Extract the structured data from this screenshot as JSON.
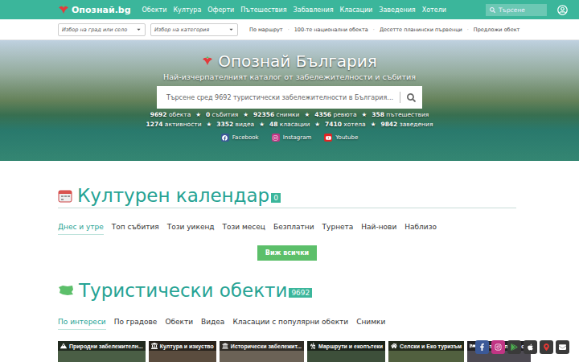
{
  "nav": {
    "logo": "Опознай.bg",
    "items": [
      "Обекти",
      "Култура",
      "Оферти",
      "Пътешествия",
      "Забавления",
      "Класации",
      "Заведения",
      "Хотели"
    ],
    "search_placeholder": "Търсене"
  },
  "filters": {
    "city_placeholder": "Избор на град или село",
    "category_placeholder": "Избор на категория",
    "links": [
      "По маршрут",
      "100-те национални обекта",
      "Десетте планински първенци",
      "Предложи обект"
    ],
    "separator": "·"
  },
  "hero": {
    "title": "Опознай България",
    "subtitle": "Най-изчерпателният каталог от забележителности и събития",
    "search_placeholder": "Търсене сред 9692 туристически забележителности в България...",
    "star": "★",
    "stats_rows": [
      [
        {
          "value": "9692",
          "label": "обекта"
        },
        {
          "value": "0",
          "label": "събития"
        },
        {
          "value": "92356",
          "label": "снимки"
        },
        {
          "value": "4356",
          "label": "ревюта"
        },
        {
          "value": "358",
          "label": "пътешествия"
        }
      ],
      [
        {
          "value": "1274",
          "label": "активности"
        },
        {
          "value": "3352",
          "label": "видеа"
        },
        {
          "value": "48",
          "label": "класации"
        },
        {
          "value": "7410",
          "label": "хотела"
        },
        {
          "value": "9842",
          "label": "заведения"
        }
      ]
    ],
    "social": [
      "Facebook",
      "Instagram",
      "Youtube"
    ]
  },
  "calendar": {
    "title": "Културен календар",
    "count": "0",
    "tabs": [
      {
        "label": "Днес и утре",
        "selected": true
      },
      {
        "label": "Топ събития",
        "selected": false
      },
      {
        "label": "Този уикенд",
        "selected": false
      },
      {
        "label": "Този месец",
        "selected": false
      },
      {
        "label": "Безплатни",
        "selected": false
      },
      {
        "label": "Турнета",
        "selected": false
      },
      {
        "label": "Най-нови",
        "selected": false
      },
      {
        "label": "Наблизо",
        "selected": false
      }
    ],
    "button": "Виж всички"
  },
  "objects": {
    "title": "Туристически обекти",
    "count": "9692",
    "tabs": [
      {
        "label": "По интереси",
        "selected": true
      },
      {
        "label": "По градове",
        "selected": false
      },
      {
        "label": "Обекти",
        "selected": false
      },
      {
        "label": "Видеа",
        "selected": false
      },
      {
        "label": "Класации с популярни обекти",
        "selected": false
      },
      {
        "label": "Снимки",
        "selected": false
      }
    ],
    "cards": [
      "Природни забележителн...",
      "Култура и изкуство",
      "Исторически забележит...",
      "Маршрути и екопътеки",
      "Селски и Еко туризъм",
      "Места за подслон"
    ]
  }
}
